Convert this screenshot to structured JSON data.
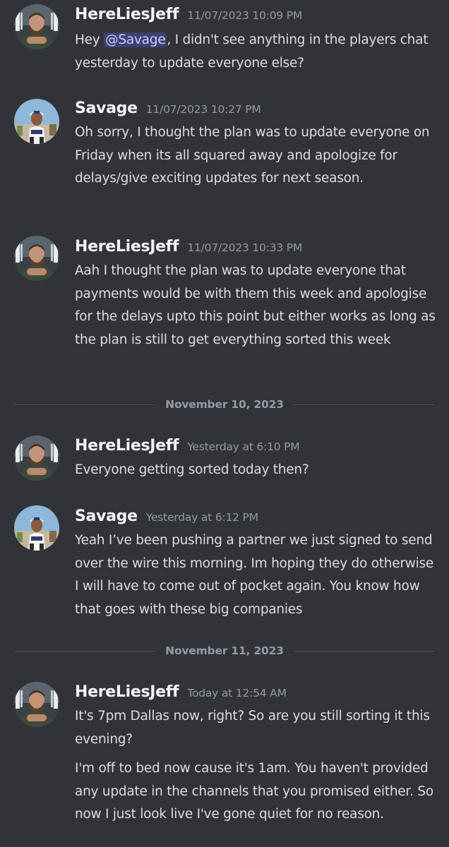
{
  "messages": [
    {
      "author": "HereLiesJeff",
      "timestamp": "11/07/2023 10:09 PM",
      "text_before": "Hey ",
      "mention": "@Savage",
      "text_after": ", I didn't see anything in the players chat yesterday to update everyone else?"
    },
    {
      "author": "Savage",
      "timestamp": "11/07/2023 10:27 PM",
      "text": "Oh sorry, I thought the plan was to update everyone on Friday when its all squared away and apologize for delays/give exciting updates for next season."
    },
    {
      "author": "HereLiesJeff",
      "timestamp": "11/07/2023 10:33 PM",
      "text": "Aah I thought the plan was to update everyone that payments would be with them this week and apologise for the delays upto this point but either works as long as the plan is still to get everything sorted this week"
    },
    {
      "author": "HereLiesJeff",
      "timestamp": "Yesterday at 6:10 PM",
      "text": "Everyone getting sorted today then?"
    },
    {
      "author": "Savage",
      "timestamp": "Yesterday at 6:12 PM",
      "text": "Yeah I’ve been pushing a partner we just signed to send over the wire this morning. Im hoping they do otherwise I will have to come out of pocket again. You know how that goes with these big companies"
    },
    {
      "author": "HereLiesJeff",
      "timestamp": "Today at 12:54 AM",
      "text": "It's 7pm Dallas now, right? So are you still sorting it this evening?",
      "followup": "I'm off to bed now cause it's 1am. You haven't provided any update in the channels that you promised either. So now I just look live I've gone quiet for no reason."
    }
  ],
  "dividers": [
    "November 10, 2023",
    "November 11, 2023"
  ],
  "icons": {
    "jeff_avatar": "bearded-man-avatar",
    "savage_avatar": "man-in-cap-avatar"
  },
  "colors": {
    "background": "#313338",
    "username": "#f2f3f5",
    "timestamp": "#949ba4",
    "message_text": "#dbdee1",
    "mention_bg": "#3c4270",
    "mention_text": "#c9cdfb"
  }
}
